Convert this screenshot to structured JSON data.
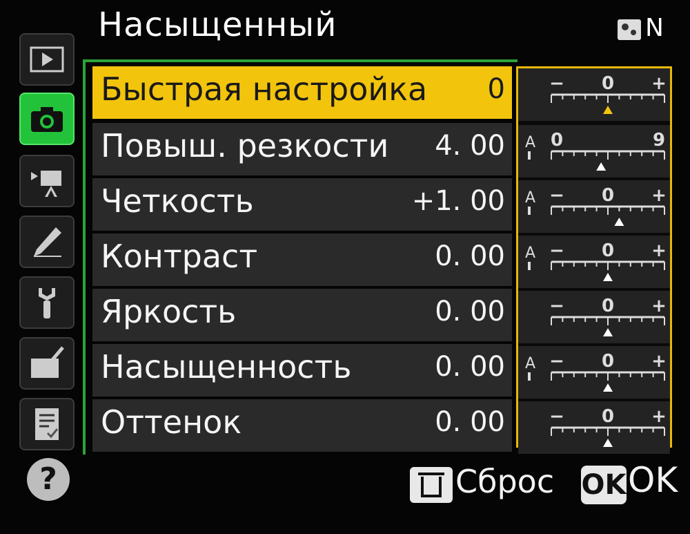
{
  "header": {
    "title": "Насыщенный",
    "mode_badge": "N"
  },
  "tabs": [
    {
      "name": "playback-menu",
      "icon": "play-icon",
      "active": false
    },
    {
      "name": "shooting-menu",
      "icon": "camera-icon",
      "active": true
    },
    {
      "name": "movie-menu",
      "icon": "movie-camera-icon",
      "active": false
    },
    {
      "name": "custom-settings",
      "icon": "pencil-icon",
      "active": false
    },
    {
      "name": "setup-menu",
      "icon": "wrench-icon",
      "active": false
    },
    {
      "name": "retouch-menu",
      "icon": "retouch-icon",
      "active": false
    },
    {
      "name": "my-menu",
      "icon": "checklist-icon",
      "active": false
    }
  ],
  "help": {
    "label": "?"
  },
  "settings": [
    {
      "label": "Быстрая настройка",
      "value": "0",
      "selected": true
    },
    {
      "label": "Повыш. резкости",
      "value": "4. 00",
      "selected": false
    },
    {
      "label": "Четкость",
      "value": "+1. 00",
      "selected": false
    },
    {
      "label": "Контраст",
      "value": "0. 00",
      "selected": false
    },
    {
      "label": "Яркость",
      "value": "0. 00",
      "selected": false
    },
    {
      "label": "Насыщенность",
      "value": "0. 00",
      "selected": false
    },
    {
      "label": "Оттенок",
      "value": "0. 00",
      "selected": false
    }
  ],
  "scales": [
    {
      "auto": false,
      "left": "−",
      "center": "0",
      "right": "+",
      "marker": 0.5,
      "marker_color": "#f2c40c"
    },
    {
      "auto": true,
      "left": "0",
      "center": "",
      "right": "9",
      "marker": 0.44,
      "marker_color": "#ffffff"
    },
    {
      "auto": true,
      "left": "−",
      "center": "0",
      "right": "+",
      "marker": 0.6,
      "marker_color": "#ffffff"
    },
    {
      "auto": true,
      "left": "−",
      "center": "0",
      "right": "+",
      "marker": 0.5,
      "marker_color": "#ffffff"
    },
    {
      "auto": false,
      "left": "−",
      "center": "0",
      "right": "+",
      "marker": 0.5,
      "marker_color": "#ffffff"
    },
    {
      "auto": true,
      "left": "−",
      "center": "0",
      "right": "+",
      "marker": 0.5,
      "marker_color": "#ffffff"
    },
    {
      "auto": false,
      "left": "−",
      "center": "0",
      "right": "+",
      "marker": 0.5,
      "marker_color": "#ffffff"
    }
  ],
  "footer": {
    "reset_label": "Сброс",
    "ok_button": "OK",
    "ok_label": "OK"
  }
}
